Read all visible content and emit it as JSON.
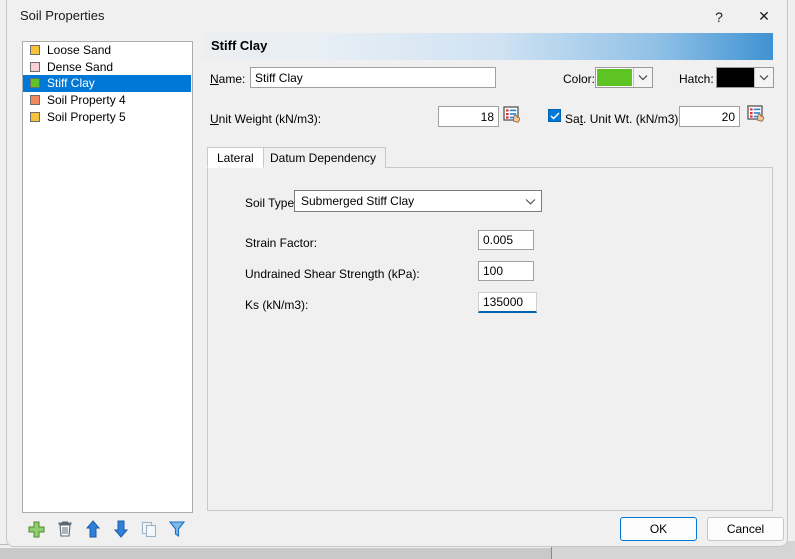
{
  "window": {
    "title": "Soil Properties",
    "help_icon": "?",
    "close_icon": "✕"
  },
  "list": {
    "items": [
      {
        "label": "Loose Sand",
        "color": "#f5c23c",
        "selected": false
      },
      {
        "label": "Dense Sand",
        "color": "#f8cfd6",
        "selected": false
      },
      {
        "label": "Stiff Clay",
        "color": "#5ec424",
        "selected": true
      },
      {
        "label": "Soil Property 4",
        "color": "#f08a5d",
        "selected": false
      },
      {
        "label": "Soil Property 5",
        "color": "#f5c23c",
        "selected": false
      }
    ],
    "toolbar": [
      {
        "name": "add-icon",
        "tip": "Add"
      },
      {
        "name": "delete-icon",
        "tip": "Delete"
      },
      {
        "name": "move-up-icon",
        "tip": "Move Up"
      },
      {
        "name": "move-down-icon",
        "tip": "Move Down"
      },
      {
        "name": "duplicate-icon",
        "tip": "Duplicate"
      },
      {
        "name": "filter-icon",
        "tip": "Filter"
      }
    ]
  },
  "panel": {
    "banner_title": "Stiff Clay",
    "name_label": "Name:",
    "name_label_accel": "N",
    "name_value": "Stiff Clay",
    "color_label": "Color:",
    "color_value": "#5ec424",
    "hatch_label": "Hatch:",
    "hatch_value": "#000000",
    "unit_weight_label": "Unit Weight (kN/m3):",
    "unit_weight_accel": "U",
    "unit_weight_value": "18",
    "sat_unit_weight_label": "Sat. Unit Wt. (kN/m3):",
    "sat_unit_weight_accel": "t",
    "sat_unit_weight_value": "20",
    "sat_unit_weight_checked": true,
    "pick_icon": "table-pick-icon"
  },
  "tabs": [
    {
      "label": "Lateral",
      "active": true
    },
    {
      "label": "Datum Dependency",
      "active": false
    }
  ],
  "lateral": {
    "soil_type_label": "Soil Type:",
    "soil_type_value": "Submerged Stiff Clay",
    "soil_type_options": [
      "Submerged Stiff Clay"
    ],
    "fields": [
      {
        "label": "Strain Factor:",
        "value": "0.005",
        "focused": false
      },
      {
        "label": "Undrained Shear Strength (kPa):",
        "value": "100",
        "focused": false
      },
      {
        "label": "Ks (kN/m3):",
        "value": "135000",
        "focused": true
      }
    ]
  },
  "footer": {
    "ok_label": "OK",
    "cancel_label": "Cancel"
  },
  "colors": {
    "accent": "#0078d7",
    "banner_end": "#3f92d2",
    "selection": "#0078d7",
    "dialog_bg": "#f0f0f0"
  }
}
